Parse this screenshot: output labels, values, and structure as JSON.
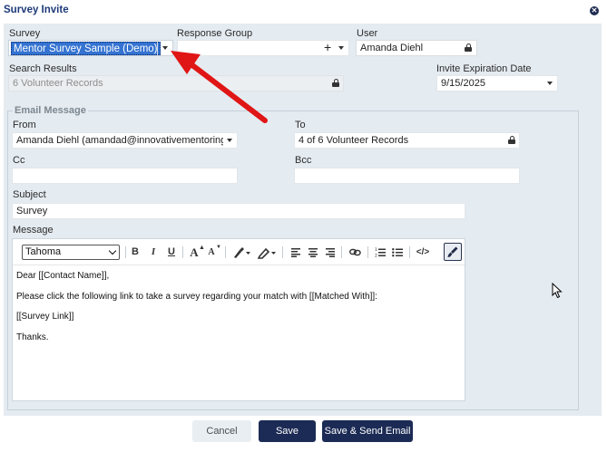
{
  "dialog": {
    "title": "Survey Invite"
  },
  "form": {
    "survey_label": "Survey",
    "survey_value": "Mentor Survey Sample (Demo)",
    "response_group_label": "Response Group",
    "response_group_value": "",
    "add_symbol": "+",
    "user_label": "User",
    "user_value": "Amanda Diehl",
    "search_results_label": "Search Results",
    "search_results_value": "6 Volunteer Records",
    "expiration_label": "Invite Expiration Date",
    "expiration_value": "9/15/2025"
  },
  "email": {
    "legend": "Email Message",
    "from_label": "From",
    "from_value": "Amanda Diehl (amandad@innovativementoring",
    "to_label": "To",
    "to_value": "4 of 6 Volunteer Records",
    "cc_label": "Cc",
    "cc_value": "",
    "bcc_label": "Bcc",
    "bcc_value": "",
    "subject_label": "Subject",
    "subject_value": "Survey",
    "message_label": "Message",
    "font_value": "Tahoma",
    "body": {
      "line1": "Dear [[Contact Name]],",
      "line2": "Please click the following link to take a survey regarding your match with [[Matched With]]:",
      "line3": "[[Survey Link]]",
      "line4": "Thanks."
    }
  },
  "toolbar": {
    "bold": "B",
    "italic": "I",
    "underline": "U",
    "grow": "A",
    "shrink": "A",
    "code": "</>"
  },
  "buttons": {
    "cancel": "Cancel",
    "save": "Save",
    "save_send": "Save & Send Email"
  },
  "colors": {
    "accent": "#1c2b55",
    "panel": "#e4ebf1",
    "selection": "#3473d1",
    "annotation_arrow": "#e01515"
  }
}
